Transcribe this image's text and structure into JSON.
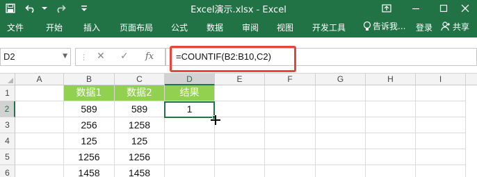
{
  "app": {
    "title": "Excel演示.xlsx - Excel"
  },
  "quick_access": {
    "save_icon": "save-icon",
    "undo_icon": "undo-icon",
    "redo_icon": "redo-icon",
    "customize_icon": "customize-qat-icon"
  },
  "window_controls": {
    "ribbon_display_icon": "ribbon-display-icon",
    "minimize_icon": "minimize-icon",
    "restore_icon": "restore-icon",
    "close_icon": "close-icon"
  },
  "ribbon": {
    "tabs": [
      "文件",
      "开始",
      "插入",
      "页面布局",
      "公式",
      "数据",
      "审阅",
      "视图",
      "开发工具"
    ],
    "tell_me": "告诉我...",
    "sign_in": "登录",
    "share": "共享"
  },
  "formula_bar": {
    "name_box": "D2",
    "formula": "=COUNTIF(B2:B10,C2)",
    "cancel_icon": "cancel-icon",
    "enter_icon": "enter-icon",
    "function_icon": "fx-icon"
  },
  "sheet": {
    "columns": [
      "A",
      "B",
      "C",
      "D",
      "E",
      "F",
      "G",
      "H",
      "I"
    ],
    "rows": [
      "1",
      "2",
      "3",
      "4",
      "5",
      "6"
    ],
    "headers": {
      "b": "数据1",
      "c": "数据2",
      "d": "结果"
    },
    "data": [
      {
        "b": "589",
        "c": "589",
        "d": "1"
      },
      {
        "b": "256",
        "c": "1258",
        "d": ""
      },
      {
        "b": "125",
        "c": "125",
        "d": ""
      },
      {
        "b": "1256",
        "c": "1256",
        "d": ""
      },
      {
        "b": "1458",
        "c": "1458",
        "d": ""
      }
    ],
    "selected_cell": "D2"
  },
  "colors": {
    "excel_green": "#217346",
    "header_fill": "#92d050",
    "highlight_red": "#e8443a"
  }
}
